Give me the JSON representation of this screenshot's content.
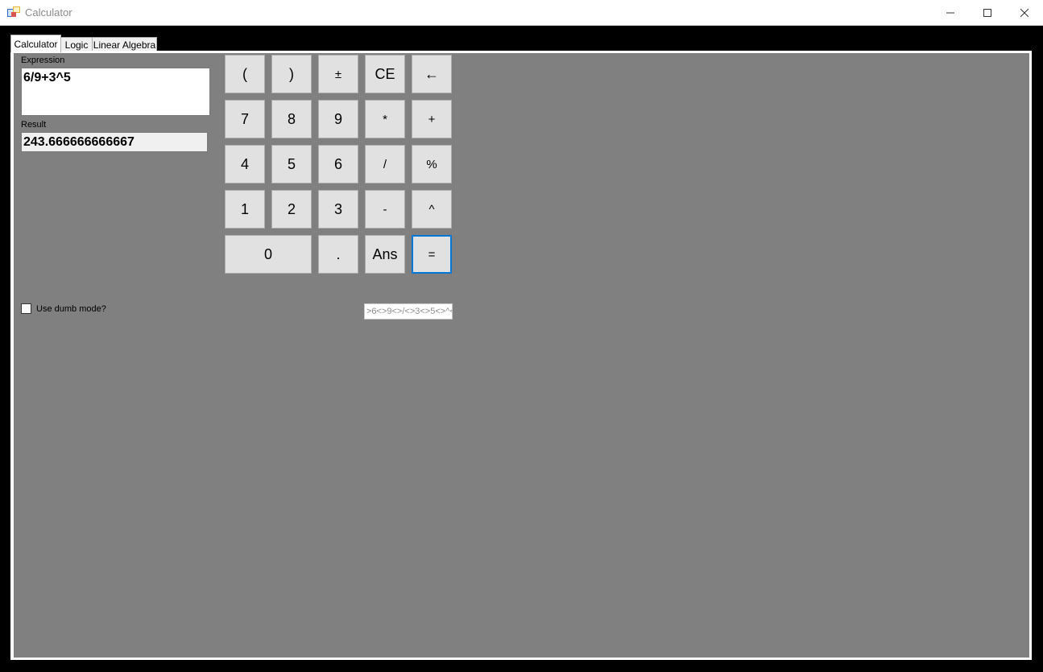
{
  "window": {
    "title": "Calculator",
    "controls": {
      "minimize": "minimize-icon",
      "maximize": "maximize-icon",
      "close": "close-icon"
    }
  },
  "tabs": [
    {
      "label": "Calculator",
      "active": true
    },
    {
      "label": "Logic",
      "active": false
    },
    {
      "label": "Linear Algebra",
      "active": false
    }
  ],
  "calculator": {
    "expression_label": "Expression",
    "expression_value": "6/9+3^5",
    "result_label": "Result",
    "result_value": "243.666666666667",
    "keys": [
      "(",
      ")",
      "±",
      "CE",
      "←",
      "7",
      "8",
      "9",
      "*",
      "+",
      "4",
      "5",
      "6",
      "/",
      "%",
      "1",
      "2",
      "3",
      "-",
      "^",
      "0",
      ".",
      "Ans",
      "="
    ],
    "dumb_mode_label": "Use dumb mode?",
    "dumb_mode_checked": false,
    "token_output": ">6<>9<>/<>3<>5<>^<"
  },
  "colors": {
    "panel": "#808080",
    "focus": "#0078d7",
    "button": "#e1e1e1"
  }
}
